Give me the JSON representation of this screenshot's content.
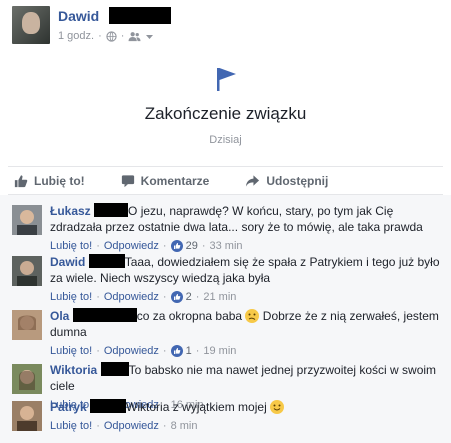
{
  "post": {
    "author": "Dawid",
    "time": "1 godz.",
    "meta_icons": [
      "globe-icon",
      "friends-icon",
      "dropdown-icon"
    ]
  },
  "life_event": {
    "icon": "flag-icon",
    "title": "Zakończenie związku",
    "date": "Dzisiaj"
  },
  "actions": {
    "like": "Lubię to!",
    "comment": "Komentarze",
    "share": "Udostępnij"
  },
  "comments": [
    {
      "name": "Łukasz",
      "text": "O jezu, naprawdę? W końcu, stary, po tym jak Cię zdradzała przez ostatnie dwa lata... sory że to mówię, ale taka prawda",
      "like": "Lubię to!",
      "reply": "Odpowiedz",
      "likes": "29",
      "time": "33 min"
    },
    {
      "name": "Dawid",
      "text": "Taaa, dowiedziałem się że spała z Patrykiem i tego już było za wiele. Niech wszyscy wiedzą jaka była",
      "like": "Lubię to!",
      "reply": "Odpowiedz",
      "likes": "2",
      "time": "21 min"
    },
    {
      "name": "Ola",
      "text_before": "co za okropna baba",
      "text_after": "Dobrze że z nią zerwałeś, jestem dumna",
      "like": "Lubię to!",
      "reply": "Odpowiedz",
      "likes": "1",
      "time": "19 min"
    },
    {
      "name": "Wiktoria",
      "text": "To babsko nie ma nawet jednej przyzwoitej kości w swoim ciele",
      "like": "Lubię to!",
      "reply": "Odpowiedz",
      "time": "16 min"
    },
    {
      "name": "Patryk",
      "text": "Wiktoria z wyjątkiem mojej",
      "like": "Lubię to!",
      "reply": "Odpowiedz",
      "time": "8 min"
    }
  ]
}
